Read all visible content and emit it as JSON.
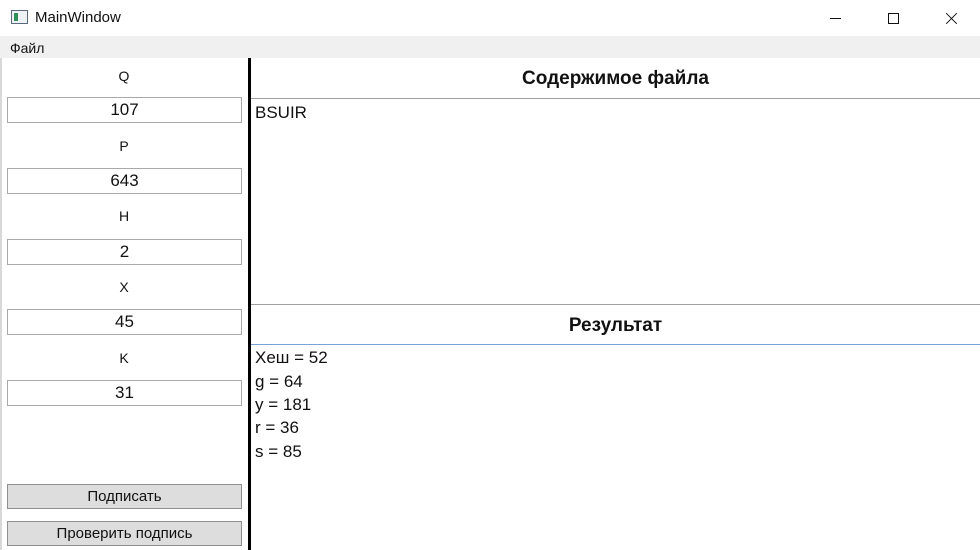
{
  "window": {
    "title": "MainWindow",
    "minimize_icon": "minimize-icon",
    "maximize_icon": "maximize-icon",
    "close_icon": "close-icon"
  },
  "menu": {
    "file_label": "Файл"
  },
  "params": {
    "q": {
      "label": "Q",
      "value": "107"
    },
    "p": {
      "label": "P",
      "value": "643"
    },
    "h": {
      "label": "H",
      "value": "2"
    },
    "x": {
      "label": "X",
      "value": "45"
    },
    "k": {
      "label": "K",
      "value": "31"
    }
  },
  "buttons": {
    "sign_label": "Подписать",
    "verify_label": "Проверить подпись"
  },
  "file_section": {
    "title": "Содержимое файла",
    "content": "BSUIR"
  },
  "result_section": {
    "title": "Результат",
    "lines": [
      "Хеш = 52",
      "g = 64",
      "y = 181",
      "r = 36",
      "s = 85"
    ]
  },
  "colors": {
    "menubar_bg": "#f0f0f0",
    "button_bg": "#dddddd",
    "splitter": "#000000",
    "file_divider": "#a0a0a0",
    "result_divider": "#7aa2d6"
  }
}
